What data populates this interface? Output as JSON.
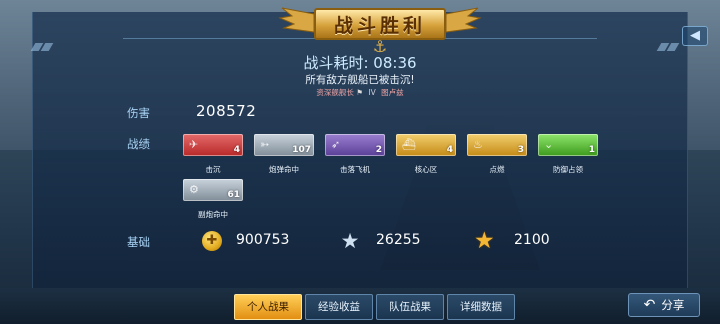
{
  "banner": {
    "title": "战斗胜利"
  },
  "battle": {
    "time_label": "战斗耗时:",
    "time_value": "08:36",
    "sunk_message": "所有敌方舰船已被击沉!",
    "subline": {
      "left": "资深舰舰长",
      "roman": "IV",
      "right": "图卢兹"
    }
  },
  "damage": {
    "label": "伤害",
    "value": "208572"
  },
  "achievements": {
    "label": "战绩",
    "items": [
      {
        "name": "击沉",
        "count": "4",
        "color": "#c33a3a"
      },
      {
        "name": "炮弹命中",
        "count": "107",
        "color": "#8f9ca6"
      },
      {
        "name": "击落飞机",
        "count": "2",
        "color": "#6b4fb0"
      },
      {
        "name": "核心区",
        "count": "4",
        "color": "#d39b22"
      },
      {
        "name": "点燃",
        "count": "3",
        "color": "#d39b22"
      },
      {
        "name": "防御占领",
        "count": "1",
        "color": "#4cb226"
      },
      {
        "name": "副炮命中",
        "count": "61",
        "color": "#8f9ca6"
      }
    ]
  },
  "base": {
    "label": "基础",
    "items": [
      {
        "icon": "gold-coin-icon",
        "value": "900753"
      },
      {
        "icon": "silver-star-icon",
        "value": "26255"
      },
      {
        "icon": "gold-star-icon",
        "value": "2100"
      }
    ]
  },
  "tabs": [
    {
      "label": "个人战果",
      "active": true
    },
    {
      "label": "经验收益",
      "active": false
    },
    {
      "label": "队伍战果",
      "active": false
    },
    {
      "label": "详细数据",
      "active": false
    }
  ],
  "share": {
    "label": "分享"
  }
}
